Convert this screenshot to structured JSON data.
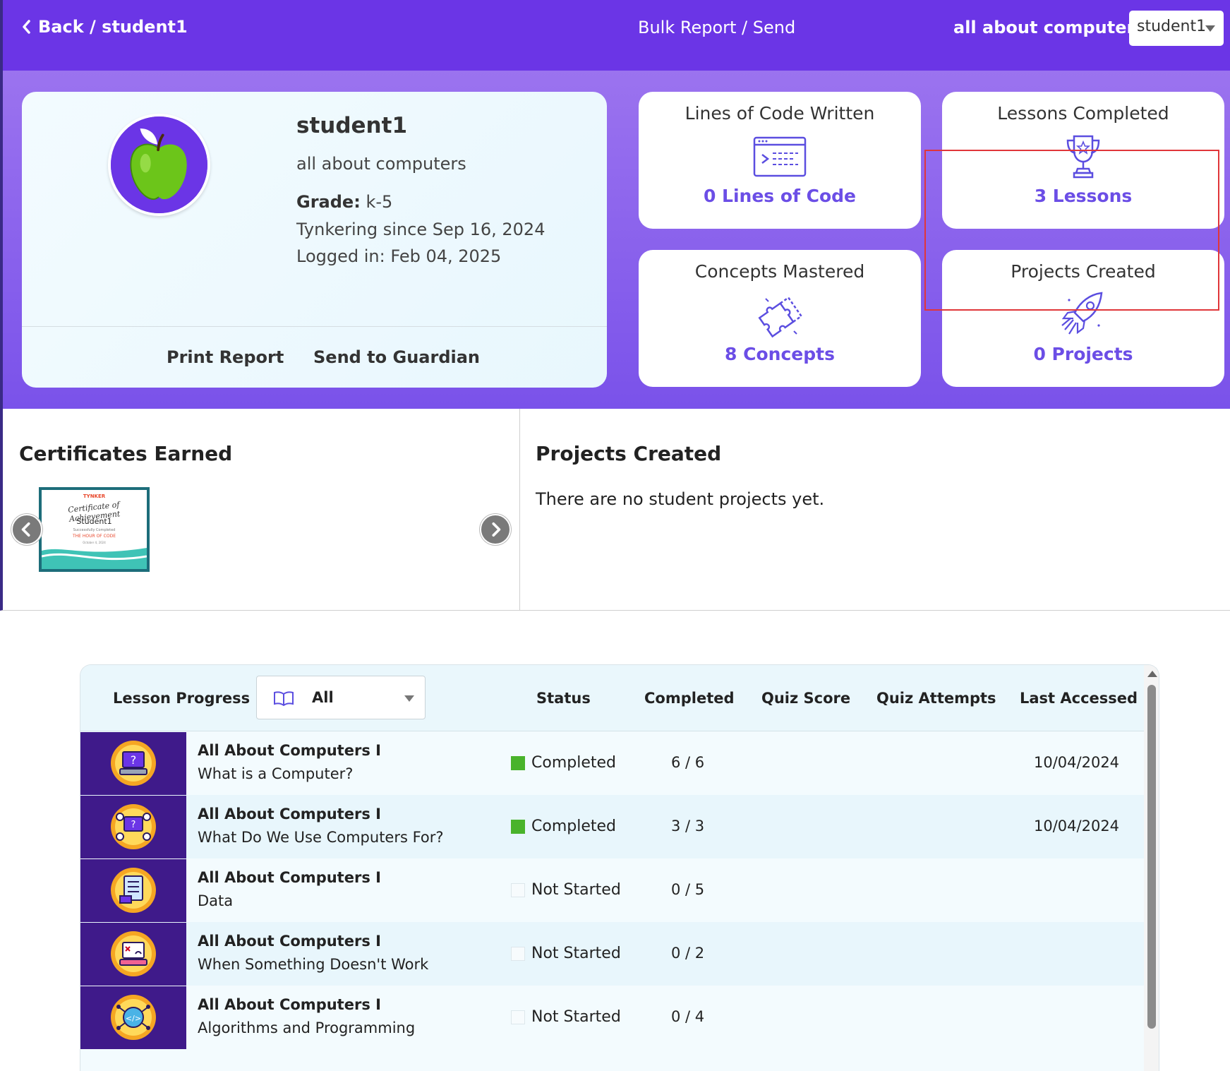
{
  "topbar": {
    "back_label": "Back / student1",
    "center_title": "Bulk Report / Send",
    "school_name": "all about computers",
    "student_select": "student1"
  },
  "profile": {
    "name": "student1",
    "school": "all about computers",
    "grade_label": "Grade:",
    "grade_value": "k-5",
    "since": "Tynkering since Sep 16, 2024",
    "logged_in": "Logged in: Feb 04, 2025",
    "print_label": "Print Report",
    "send_label": "Send to Guardian"
  },
  "stats": [
    {
      "title": "Lines of Code Written",
      "value": "0 Lines of Code",
      "icon": "code-window-icon"
    },
    {
      "title": "Lessons Completed",
      "value": "3 Lessons",
      "icon": "trophy-icon"
    },
    {
      "title": "Concepts Mastered",
      "value": "8 Concepts",
      "icon": "puzzle-icon"
    },
    {
      "title": "Projects Created",
      "value": "0 Projects",
      "icon": "rocket-icon"
    }
  ],
  "certificates": {
    "title": "Certificates Earned",
    "items": [
      {
        "brand": "TYNKER",
        "title": "Certificate of Achievement",
        "name": "Student1",
        "subtitle": "Successfully Completed",
        "event": "THE HOUR OF CODE",
        "date": "October 4, 2024"
      }
    ]
  },
  "projects": {
    "title": "Projects Created",
    "empty_text": "There are no student projects yet."
  },
  "lessons": {
    "header": {
      "progress_label": "Lesson Progress",
      "filter_value": "All",
      "status": "Status",
      "completed": "Completed",
      "quiz_score": "Quiz Score",
      "quiz_attempts": "Quiz Attempts",
      "last_accessed": "Last Accessed"
    },
    "rows": [
      {
        "course": "All About Computers I",
        "lesson": "What is a Computer?",
        "status": "Completed",
        "completed": "6 / 6",
        "last_accessed": "10/04/2024"
      },
      {
        "course": "All About Computers I",
        "lesson": "What Do We Use Computers For?",
        "status": "Completed",
        "completed": "3 / 3",
        "last_accessed": "10/04/2024"
      },
      {
        "course": "All About Computers I",
        "lesson": "Data",
        "status": "Not Started",
        "completed": "0 / 5",
        "last_accessed": ""
      },
      {
        "course": "All About Computers I",
        "lesson": "When Something Doesn't Work",
        "status": "Not Started",
        "completed": "0 / 2",
        "last_accessed": ""
      },
      {
        "course": "All About Computers I",
        "lesson": "Algorithms and Programming",
        "status": "Not Started",
        "completed": "0 / 4",
        "last_accessed": ""
      }
    ]
  },
  "colors": {
    "brand_purple": "#6b35e6",
    "stat_value": "#6b4ee6",
    "completed_green": "#49b32b",
    "highlight_red": "#e0363a"
  }
}
